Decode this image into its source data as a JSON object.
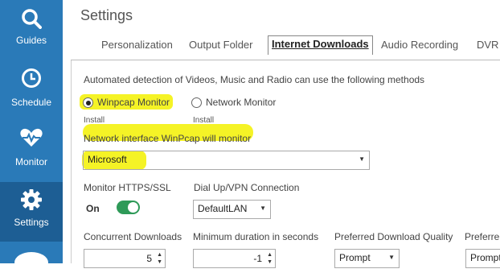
{
  "sidebar": {
    "items": [
      {
        "label": "Guides",
        "icon": "search-icon"
      },
      {
        "label": "Schedule",
        "icon": "clock-icon"
      },
      {
        "label": "Monitor",
        "icon": "heart-pulse-icon"
      },
      {
        "label": "Settings",
        "icon": "gear-icon"
      }
    ]
  },
  "header": {
    "title": "Settings"
  },
  "tabs": [
    "Personalization",
    "Output Folder",
    "Internet Downloads",
    "Audio Recording",
    "DVR"
  ],
  "panel": {
    "detection_label": "Automated detection of Videos, Music and Radio can use the following methods",
    "option_winpcap": "Winpcap Monitor",
    "option_network": "Network Monitor",
    "install_1": "Install",
    "install_2": "Install",
    "interface_label": "Network interface WinPcap will monitor",
    "interface_value": "Microsoft",
    "https_label": "Monitor HTTPS/SSL",
    "https_state": "On",
    "dialup_label": "Dial Up/VPN Connection",
    "dialup_value": "DefaultLAN",
    "concurrent_label": "Concurrent Downloads",
    "concurrent_value": "5",
    "minduration_label": "Minimum duration in seconds",
    "minduration_value": "-1",
    "quality_label": "Preferred Download Quality",
    "quality_value": "Prompt",
    "preferred2_label": "Preferre",
    "preferred2_value": "Prompt"
  },
  "colors": {
    "sidebar": "#2a7ab8",
    "sidebar_active": "#1d5e94",
    "highlight": "#f4f21a",
    "toggle_on": "#2e9a58"
  }
}
